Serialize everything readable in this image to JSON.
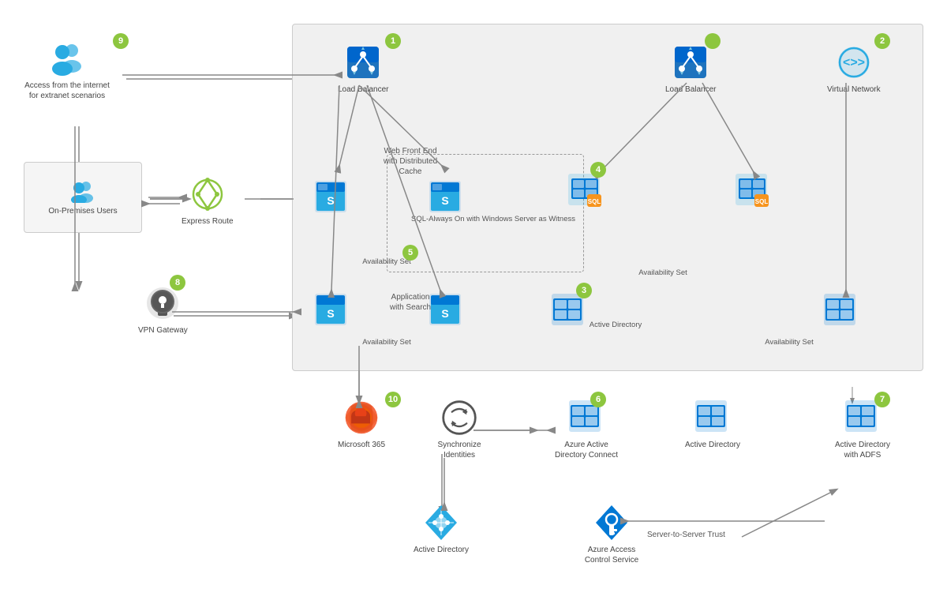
{
  "badges": {
    "colors": {
      "green": "#8dc63f"
    }
  },
  "nodes": {
    "load_balancer_1": {
      "label": "Load Balancer",
      "badge": "1"
    },
    "virtual_network": {
      "label": "Virtual Network",
      "badge": "2"
    },
    "active_directory_3": {
      "label": "Active Directory",
      "badge": "3"
    },
    "sql_4": {
      "label": "",
      "badge": "4"
    },
    "availability_set_5": {
      "label": "Availability Set",
      "badge": "5"
    },
    "azure_ad_connect_6": {
      "label": "Azure Active Directory Connect",
      "badge": "6"
    },
    "active_directory_7": {
      "label": "Active Directory with ADFS",
      "badge": "7"
    },
    "vpn_gateway_8": {
      "label": "VPN Gateway",
      "badge": "8"
    },
    "internet_access_9": {
      "label": "Access from the internet for extranet scenarios",
      "badge": "9"
    },
    "microsoft365_10": {
      "label": "Microsoft 365",
      "badge": "10"
    }
  },
  "labels": {
    "load_balancer_1": "Load Balancer",
    "virtual_network": "Virtual Network",
    "active_directory_avail": "Active Directory",
    "availability_set_label": "Availability Set",
    "web_front_end": "Web Front End\nwith Distributed\nCache",
    "application_search": "Application\nwith Search",
    "sql_always_on": "SQL-Always On with\nWindows Server as Witness",
    "on_premises_users": "On-Premises Users",
    "express_route": "Express Route",
    "vpn_gateway": "VPN Gateway",
    "internet_access": "Access from the\ninternet for extranet\nscenarios",
    "load_balancer_right": "Load Balancer",
    "microsoft_365": "Microsoft 365",
    "synchronize_identities": "Synchronize Identities",
    "azure_ad_connect": "Azure Active\nDirectory Connect",
    "active_directory_6": "Active Directory",
    "active_directory_adfs": "Active Directory\nwith ADFS",
    "active_directory_bottom": "Active Directory",
    "access_control": "Azure Access\nControl Service",
    "server_trust": "Server-to-Server Trust"
  }
}
